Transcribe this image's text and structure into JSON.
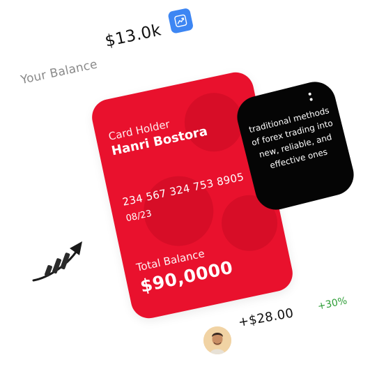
{
  "balance": {
    "label": "Your Balance",
    "value": "$13.0k",
    "trend_icon": "trend-chart-icon"
  },
  "card": {
    "holder_label": "Card Holder",
    "holder_name": "Hanri Bostora",
    "number": "234 567 324 753 8905",
    "expiry": "08/23",
    "total_label": "Total Balance",
    "total_value": "$90,0000",
    "color": "#e9112d"
  },
  "note": {
    "text": "traditional methods of forex trading into new, reliable, and effective ones",
    "menu_icon": "more-vertical-icon"
  },
  "stats": {
    "percent": "+30%",
    "percent_color": "#2f9e38"
  },
  "transaction": {
    "amount": "+$28.00",
    "avatar_icon": "user-avatar"
  },
  "colors": {
    "accent_blue": "#3d86f3",
    "background": "#ffffff"
  }
}
